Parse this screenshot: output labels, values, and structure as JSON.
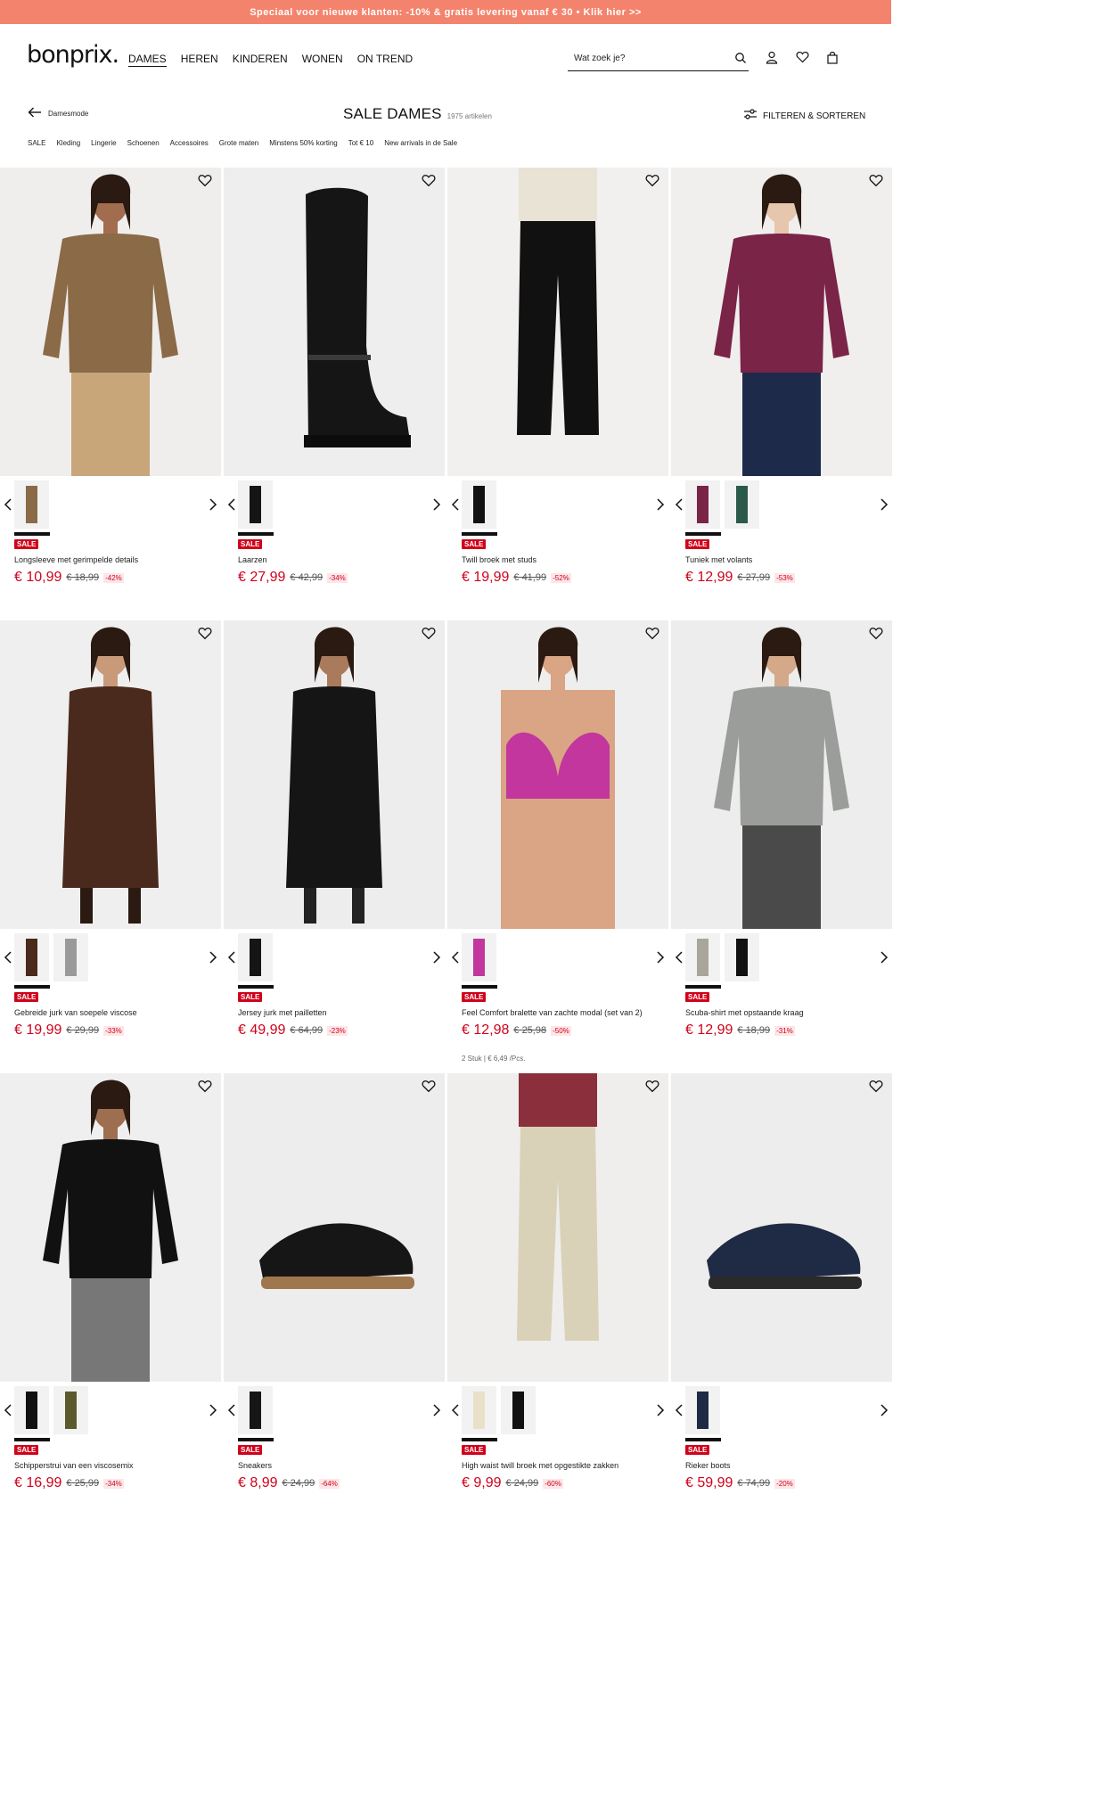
{
  "promo": "Speciaal voor nieuwe klanten: -10% & gratis levering vanaf € 30 • Klik hier >>",
  "brand": "bonprix.",
  "mainnav": [
    "DAMES",
    "HEREN",
    "KINDEREN",
    "WONEN",
    "ON TREND"
  ],
  "search": {
    "placeholder": "Wat zoek je?"
  },
  "back_label": "Damesmode",
  "page_title": "SALE DAMES",
  "article_count": "1975 artikelen",
  "filter_label": "FILTEREN & SORTEREN",
  "subnav": [
    "SALE",
    "Kleding",
    "Lingerie",
    "Schoenen",
    "Accessoires",
    "Grote maten",
    "Minstens 50% korting",
    "Tot € 10",
    "New arrivals in de Sale"
  ],
  "products": [
    {
      "name": "Longsleeve met gerimpelde details",
      "price": "€ 10,99",
      "old_price": "€ 18,99",
      "discount": "-42%",
      "badge": "SALE",
      "extra": "",
      "swatches": 1
    },
    {
      "name": "Laarzen",
      "price": "€ 27,99",
      "old_price": "€ 42,99",
      "discount": "-34%",
      "badge": "SALE",
      "extra": "",
      "swatches": 1
    },
    {
      "name": "Twill broek met studs",
      "price": "€ 19,99",
      "old_price": "€ 41,99",
      "discount": "-52%",
      "badge": "SALE",
      "extra": "",
      "swatches": 1
    },
    {
      "name": "Tuniek met volants",
      "price": "€ 12,99",
      "old_price": "€ 27,99",
      "discount": "-53%",
      "badge": "SALE",
      "extra": "",
      "swatches": 2
    },
    {
      "name": "Gebreide jurk van soepele viscose",
      "price": "€ 19,99",
      "old_price": "€ 29,99",
      "discount": "-33%",
      "badge": "SALE",
      "extra": "",
      "swatches": 2
    },
    {
      "name": "Jersey jurk met pailletten",
      "price": "€ 49,99",
      "old_price": "€ 64,99",
      "discount": "-23%",
      "badge": "SALE",
      "extra": "",
      "swatches": 1
    },
    {
      "name": "Feel Comfort bralette van zachte modal (set van 2)",
      "price": "€ 12,98",
      "old_price": "€ 25,98",
      "discount": "-50%",
      "badge": "SALE",
      "extra": "2 Stuk | € 6,49 /Pcs.",
      "swatches": 1
    },
    {
      "name": "Scuba-shirt met opstaande kraag",
      "price": "€ 12,99",
      "old_price": "€ 18,99",
      "discount": "-31%",
      "badge": "SALE",
      "extra": "",
      "swatches": 2
    },
    {
      "name": "Schipperstrui van een viscosemix",
      "price": "€ 16,99",
      "old_price": "€ 25,99",
      "discount": "-34%",
      "badge": "SALE",
      "extra": "",
      "swatches": 2
    },
    {
      "name": "Sneakers",
      "price": "€ 8,99",
      "old_price": "€ 24,99",
      "discount": "-64%",
      "badge": "SALE",
      "extra": "",
      "swatches": 1
    },
    {
      "name": "High waist twill broek met opgestikte zakken",
      "price": "€ 9,99",
      "old_price": "€ 24,99",
      "discount": "-60%",
      "badge": "SALE",
      "extra": "",
      "swatches": 2
    },
    {
      "name": "Rieker boots",
      "price": "€ 59,99",
      "old_price": "€ 74,99",
      "discount": "-20%",
      "badge": "SALE",
      "extra": "",
      "swatches": 1
    }
  ],
  "colors": {
    "promo_bg": "#f4836d",
    "sale_red": "#d0021b"
  },
  "icons": [
    "search-icon",
    "user-icon",
    "heart-icon",
    "bag-icon",
    "arrow-left-icon",
    "filter-icon",
    "chevron-left-icon",
    "chevron-right-icon"
  ]
}
